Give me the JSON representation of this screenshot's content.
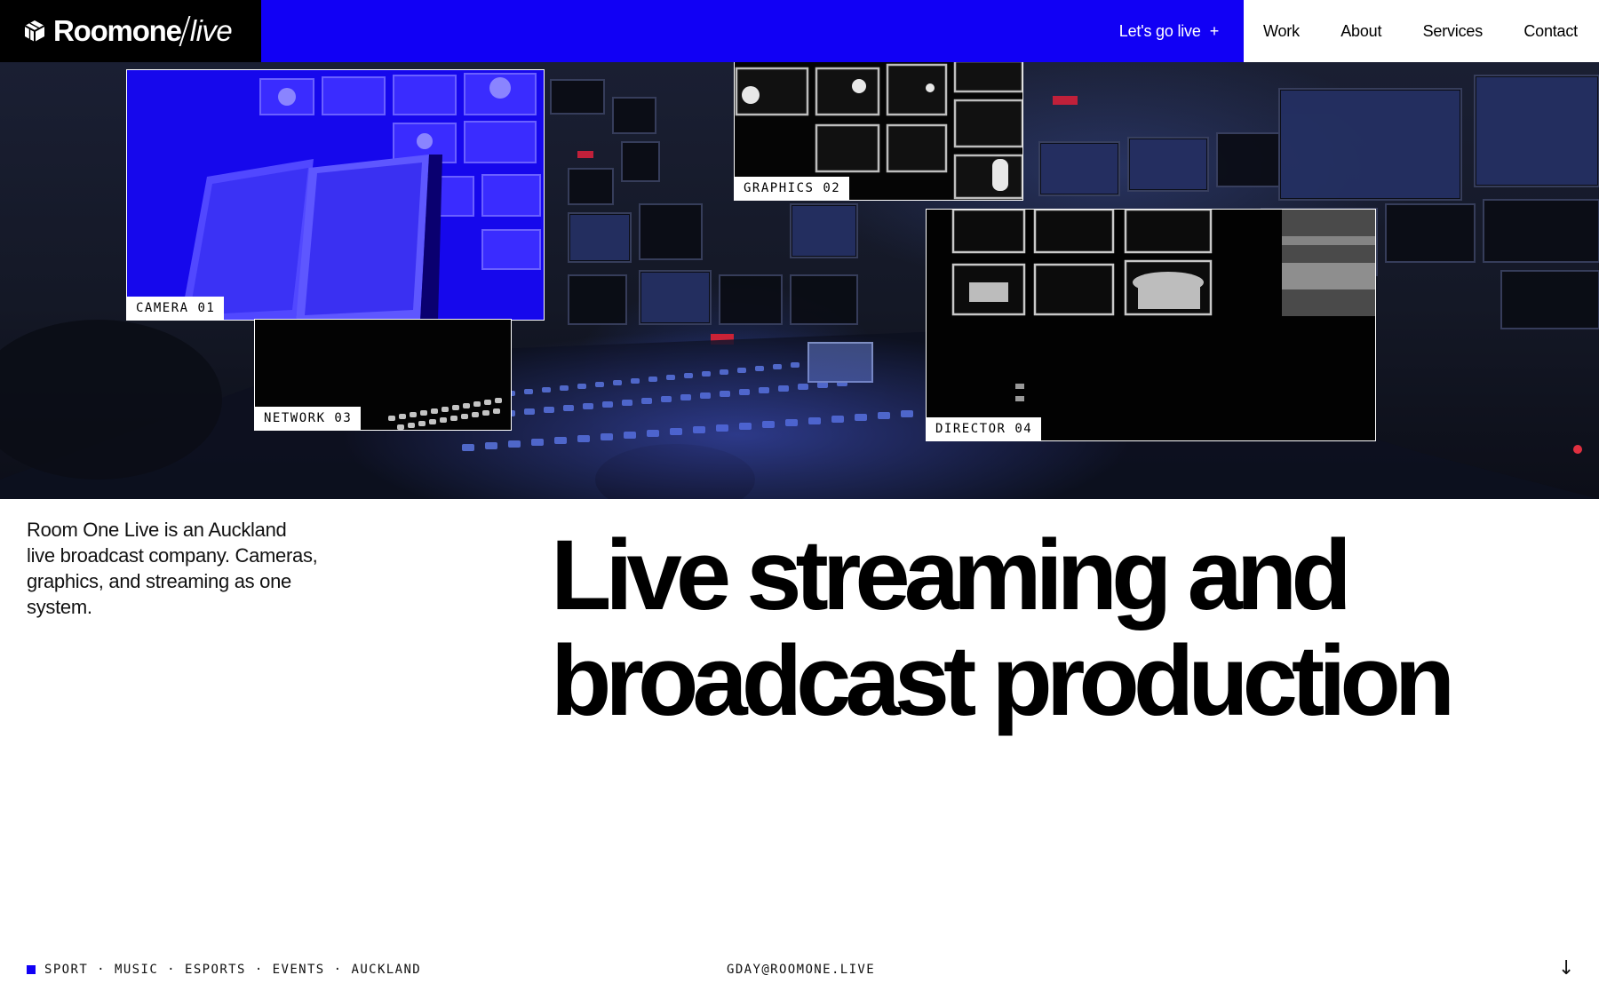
{
  "brand": {
    "name": "Roomone",
    "suffix": "live",
    "logo_icon": "cube-logo-icon"
  },
  "header": {
    "cta_label": "Let's go live",
    "cta_icon": "+",
    "nav": [
      "Work",
      "About",
      "Services",
      "Contact"
    ]
  },
  "hero": {
    "frames": [
      {
        "id": "camera",
        "label": "CAMERA 01"
      },
      {
        "id": "network",
        "label": "NETWORK 03"
      },
      {
        "id": "graphics",
        "label": "GRAPHICS 02"
      },
      {
        "id": "director",
        "label": "DIRECTOR 04"
      }
    ]
  },
  "intro": "Room One Live is an Auckland live broadcast company. Cameras, graphics, and streaming as one system.",
  "headline": {
    "line1": "Live streaming and",
    "line2": "broadcast production"
  },
  "footer": {
    "tags": [
      "SPORT",
      "MUSIC",
      "ESPORTS",
      "EVENTS",
      "AUCKLAND"
    ],
    "separator": "·",
    "email": "GDAY@ROOMONE.LIVE",
    "scroll_icon": "↓"
  },
  "colors": {
    "accent": "#1100f5",
    "dark": "#000000",
    "light": "#ffffff"
  }
}
